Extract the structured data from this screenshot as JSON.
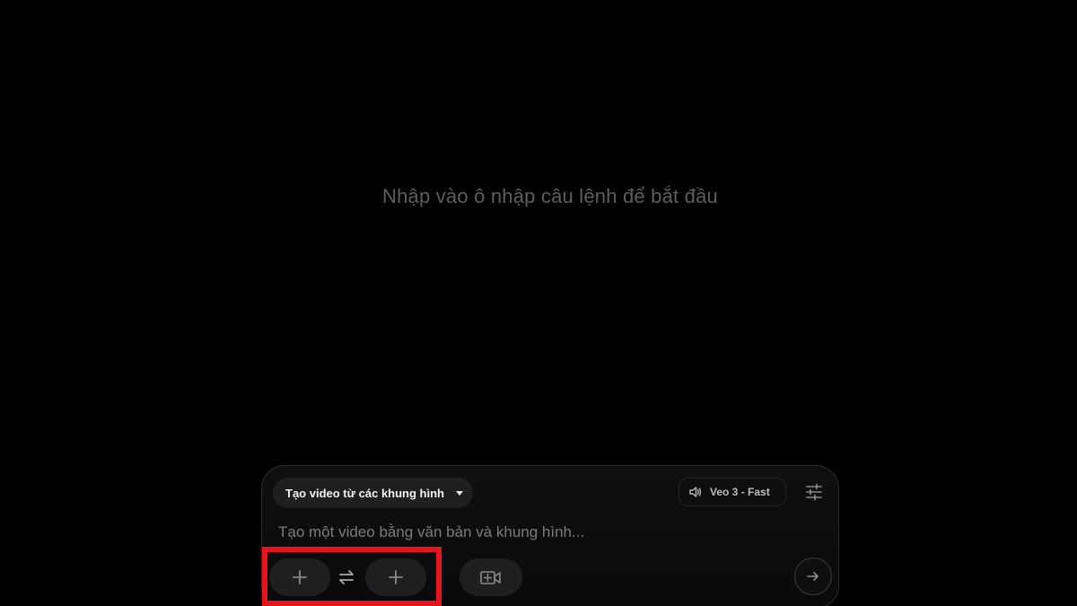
{
  "empty_state": {
    "hint": "Nhập vào ô nhập câu lệnh để bắt đầu"
  },
  "composer": {
    "mode_select": {
      "label": "Tạo video từ các khung hình",
      "icon": "chevron-down-icon"
    },
    "model_chip": {
      "label": "Veo 3 - Fast",
      "icon": "speaker-icon"
    },
    "settings_icon": "tune-icon",
    "prompt": {
      "value": "",
      "placeholder": "Tạo một video bằng văn bản và khung hình..."
    },
    "start_frame_icon": "plus-icon",
    "swap_icon": "swap-arrows-icon",
    "end_frame_icon": "plus-icon",
    "camera_icon": "video-camera-icon",
    "send_icon": "arrow-right-icon"
  },
  "colors": {
    "background": "#000000",
    "panel": "#0d0d0d",
    "chip": "#1f1f1f",
    "hint_text": "#5e5e5e",
    "highlight": "#e8141b"
  }
}
